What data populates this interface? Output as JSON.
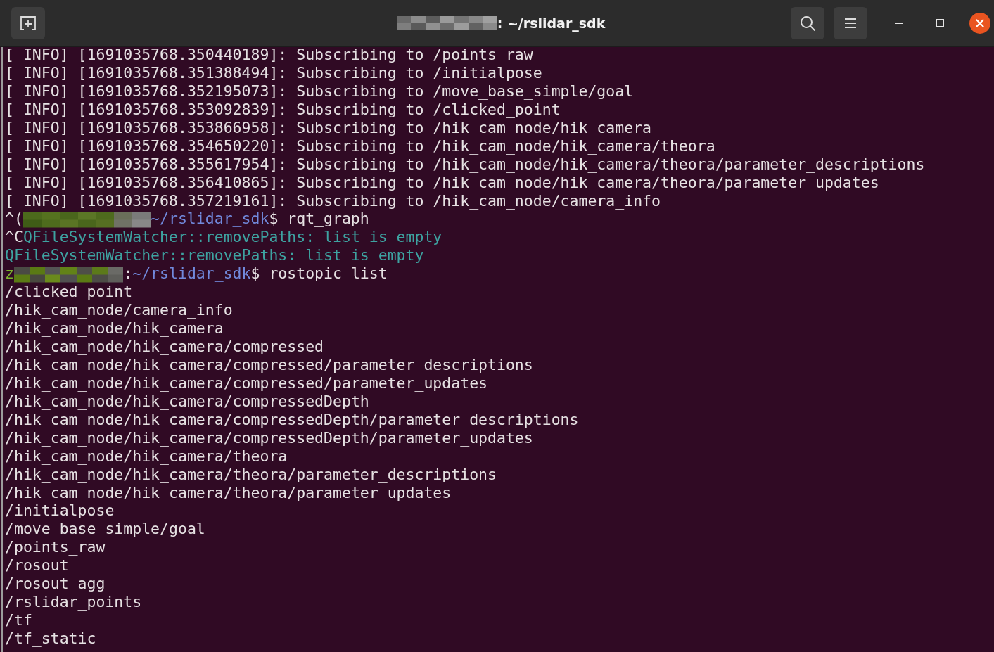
{
  "window": {
    "title": {
      "segments": [
        {
          "kind": "redacted"
        },
        {
          "kind": "text",
          "text": ": ~/rslidar_sdk"
        }
      ]
    }
  },
  "terminal": {
    "lines": [
      {
        "segments": [
          {
            "kind": "text",
            "text": "[ INFO] [1691035768.350440189]: Subscribing to /points_raw"
          }
        ]
      },
      {
        "segments": [
          {
            "kind": "text",
            "text": "[ INFO] [1691035768.351388494]: Subscribing to /initialpose"
          }
        ]
      },
      {
        "segments": [
          {
            "kind": "text",
            "text": "[ INFO] [1691035768.352195073]: Subscribing to /move_base_simple/goal"
          }
        ]
      },
      {
        "segments": [
          {
            "kind": "text",
            "text": "[ INFO] [1691035768.353092839]: Subscribing to /clicked_point"
          }
        ]
      },
      {
        "segments": [
          {
            "kind": "text",
            "text": "[ INFO] [1691035768.353866958]: Subscribing to /hik_cam_node/hik_camera"
          }
        ]
      },
      {
        "segments": [
          {
            "kind": "text",
            "text": "[ INFO] [1691035768.354650220]: Subscribing to /hik_cam_node/hik_camera/theora"
          }
        ]
      },
      {
        "segments": [
          {
            "kind": "text",
            "text": "[ INFO] [1691035768.355617954]: Subscribing to /hik_cam_node/hik_camera/theora/parameter_descriptions"
          }
        ]
      },
      {
        "segments": [
          {
            "kind": "text",
            "text": "[ INFO] [1691035768.356410865]: Subscribing to /hik_cam_node/hik_camera/theora/parameter_updates"
          }
        ]
      },
      {
        "segments": [
          {
            "kind": "text",
            "text": "[ INFO] [1691035768.357219161]: Subscribing to /hik_cam_node/camera_info"
          }
        ]
      },
      {
        "segments": [
          {
            "kind": "text",
            "text": "^("
          },
          {
            "kind": "redacted"
          },
          {
            "kind": "path",
            "text": "~/rslidar_sdk"
          },
          {
            "kind": "text",
            "text": "$ rqt_graph"
          }
        ]
      },
      {
        "segments": [
          {
            "kind": "text",
            "text": "^C"
          },
          {
            "kind": "notice",
            "text": "QFileSystemWatcher::removePaths: list is empty"
          }
        ]
      },
      {
        "segments": [
          {
            "kind": "notice",
            "text": "QFileSystemWatcher::removePaths: list is empty"
          }
        ]
      },
      {
        "segments": [
          {
            "kind": "user",
            "text": "z"
          },
          {
            "kind": "redacted"
          },
          {
            "kind": "text",
            "text": ":"
          },
          {
            "kind": "path",
            "text": "~/rslidar_sdk"
          },
          {
            "kind": "text",
            "text": "$ rostopic list"
          }
        ]
      },
      {
        "segments": [
          {
            "kind": "text",
            "text": "/clicked_point"
          }
        ]
      },
      {
        "segments": [
          {
            "kind": "text",
            "text": "/hik_cam_node/camera_info"
          }
        ]
      },
      {
        "segments": [
          {
            "kind": "text",
            "text": "/hik_cam_node/hik_camera"
          }
        ]
      },
      {
        "segments": [
          {
            "kind": "text",
            "text": "/hik_cam_node/hik_camera/compressed"
          }
        ]
      },
      {
        "segments": [
          {
            "kind": "text",
            "text": "/hik_cam_node/hik_camera/compressed/parameter_descriptions"
          }
        ]
      },
      {
        "segments": [
          {
            "kind": "text",
            "text": "/hik_cam_node/hik_camera/compressed/parameter_updates"
          }
        ]
      },
      {
        "segments": [
          {
            "kind": "text",
            "text": "/hik_cam_node/hik_camera/compressedDepth"
          }
        ]
      },
      {
        "segments": [
          {
            "kind": "text",
            "text": "/hik_cam_node/hik_camera/compressedDepth/parameter_descriptions"
          }
        ]
      },
      {
        "segments": [
          {
            "kind": "text",
            "text": "/hik_cam_node/hik_camera/compressedDepth/parameter_updates"
          }
        ]
      },
      {
        "segments": [
          {
            "kind": "text",
            "text": "/hik_cam_node/hik_camera/theora"
          }
        ]
      },
      {
        "segments": [
          {
            "kind": "text",
            "text": "/hik_cam_node/hik_camera/theora/parameter_descriptions"
          }
        ]
      },
      {
        "segments": [
          {
            "kind": "text",
            "text": "/hik_cam_node/hik_camera/theora/parameter_updates"
          }
        ]
      },
      {
        "segments": [
          {
            "kind": "text",
            "text": "/initialpose"
          }
        ]
      },
      {
        "segments": [
          {
            "kind": "text",
            "text": "/move_base_simple/goal"
          }
        ]
      },
      {
        "segments": [
          {
            "kind": "text",
            "text": "/points_raw"
          }
        ]
      },
      {
        "segments": [
          {
            "kind": "text",
            "text": "/rosout"
          }
        ]
      },
      {
        "segments": [
          {
            "kind": "text",
            "text": "/rosout_agg"
          }
        ]
      },
      {
        "segments": [
          {
            "kind": "text",
            "text": "/rslidar_points"
          }
        ]
      },
      {
        "segments": [
          {
            "kind": "text",
            "text": "/tf"
          }
        ]
      },
      {
        "segments": [
          {
            "kind": "text",
            "text": "/tf_static"
          }
        ]
      }
    ]
  }
}
